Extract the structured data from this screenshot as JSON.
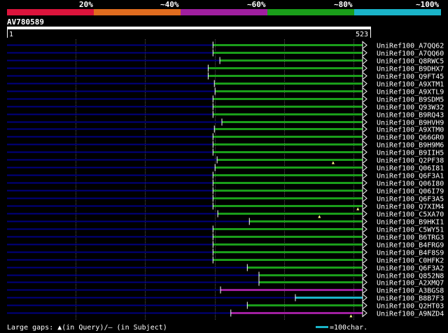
{
  "colors": {
    "background": "#000000",
    "scale_red": "#dc143c",
    "scale_orange": "#e06c1f",
    "scale_purple": "#a01fa0",
    "scale_green": "#1a9e1a",
    "scale_cyan": "#1ab4c8",
    "query_line": "#000080",
    "grid": "#555555",
    "gap_marker": "#ffff88"
  },
  "identity_scale": {
    "labels": [
      "20%",
      "~40%",
      "~60%",
      "~80%",
      "~100%"
    ]
  },
  "query": {
    "id": "AV780589",
    "start_label": "1",
    "end_label": "523",
    "length": 523
  },
  "hits": [
    {
      "id": "UniRef100_A7QQ62",
      "start": 300,
      "end": 523,
      "color": "green",
      "gaps": []
    },
    {
      "id": "UniRef100_A7QQ60",
      "start": 300,
      "end": 523,
      "color": "green",
      "gaps": []
    },
    {
      "id": "UniRef100_Q8RWC5",
      "start": 310,
      "end": 523,
      "color": "green",
      "gaps": []
    },
    {
      "id": "UniRef100_B9DHX7",
      "start": 293,
      "end": 523,
      "color": "green",
      "gaps": []
    },
    {
      "id": "UniRef100_Q9FT45",
      "start": 293,
      "end": 523,
      "color": "green",
      "gaps": []
    },
    {
      "id": "UniRef100_A9XTM1",
      "start": 302,
      "end": 523,
      "color": "green",
      "gaps": []
    },
    {
      "id": "UniRef100_A9XTL9",
      "start": 303,
      "end": 523,
      "color": "green",
      "gaps": []
    },
    {
      "id": "UniRef100_B9SDM5",
      "start": 300,
      "end": 523,
      "color": "green",
      "gaps": []
    },
    {
      "id": "UniRef100_Q93W32",
      "start": 300,
      "end": 523,
      "color": "green",
      "gaps": []
    },
    {
      "id": "UniRef100_B9RQ43",
      "start": 300,
      "end": 523,
      "color": "green",
      "gaps": []
    },
    {
      "id": "UniRef100_B9HVH9",
      "start": 313,
      "end": 523,
      "color": "green",
      "gaps": []
    },
    {
      "id": "UniRef100_A9XTM0",
      "start": 302,
      "end": 523,
      "color": "green",
      "gaps": []
    },
    {
      "id": "UniRef100_Q66GR0",
      "start": 300,
      "end": 523,
      "color": "green",
      "gaps": []
    },
    {
      "id": "UniRef100_B9H9M6",
      "start": 300,
      "end": 523,
      "color": "green",
      "gaps": []
    },
    {
      "id": "UniRef100_B9IIH5",
      "start": 300,
      "end": 523,
      "color": "green",
      "gaps": []
    },
    {
      "id": "UniRef100_Q2PF38",
      "start": 306,
      "end": 523,
      "color": "green",
      "gaps": [
        475
      ]
    },
    {
      "id": "UniRef100_Q06I81",
      "start": 303,
      "end": 523,
      "color": "green",
      "gaps": []
    },
    {
      "id": "UniRef100_Q6F3A1",
      "start": 300,
      "end": 523,
      "color": "green",
      "gaps": []
    },
    {
      "id": "UniRef100_Q06I80",
      "start": 300,
      "end": 523,
      "color": "green",
      "gaps": []
    },
    {
      "id": "UniRef100_Q06I79",
      "start": 300,
      "end": 523,
      "color": "green",
      "gaps": []
    },
    {
      "id": "UniRef100_Q6F3A5",
      "start": 300,
      "end": 523,
      "color": "green",
      "gaps": []
    },
    {
      "id": "UniRef100_Q7XIM4",
      "start": 300,
      "end": 523,
      "color": "green",
      "gaps": [
        511
      ]
    },
    {
      "id": "UniRef100_C5XA70",
      "start": 307,
      "end": 523,
      "color": "green",
      "gaps": [
        455
      ]
    },
    {
      "id": "UniRef100_B9HKI1",
      "start": 353,
      "end": 523,
      "color": "green",
      "gaps": []
    },
    {
      "id": "UniRef100_C5WY51",
      "start": 300,
      "end": 523,
      "color": "green",
      "gaps": []
    },
    {
      "id": "UniRef100_B6TRG3",
      "start": 300,
      "end": 523,
      "color": "green",
      "gaps": []
    },
    {
      "id": "UniRef100_B4FRG9",
      "start": 300,
      "end": 523,
      "color": "green",
      "gaps": []
    },
    {
      "id": "UniRef100_B4F8S9",
      "start": 300,
      "end": 523,
      "color": "green",
      "gaps": []
    },
    {
      "id": "UniRef100_C0HFK2",
      "start": 300,
      "end": 523,
      "color": "green",
      "gaps": []
    },
    {
      "id": "UniRef100_Q6F3A2",
      "start": 350,
      "end": 523,
      "color": "green",
      "gaps": []
    },
    {
      "id": "UniRef100_Q852N8",
      "start": 367,
      "end": 523,
      "color": "green",
      "gaps": []
    },
    {
      "id": "UniRef100_A2XMQ7",
      "start": 367,
      "end": 523,
      "color": "green",
      "gaps": []
    },
    {
      "id": "UniRef100_A3BGS8",
      "start": 311,
      "end": 523,
      "color": "purple",
      "gaps": []
    },
    {
      "id": "UniRef100_B8B7F3",
      "start": 420,
      "end": 523,
      "color": "cyan",
      "gaps": []
    },
    {
      "id": "UniRef100_Q2HT03",
      "start": 350,
      "end": 523,
      "color": "green",
      "gaps": []
    },
    {
      "id": "UniRef100_A9NZD4",
      "start": 326,
      "end": 523,
      "color": "purple",
      "gaps": [
        501
      ]
    }
  ],
  "footer": {
    "gaps_label": "Large gaps: ▲(in Query)/— (in Subject)",
    "scale_label": "=100char."
  }
}
